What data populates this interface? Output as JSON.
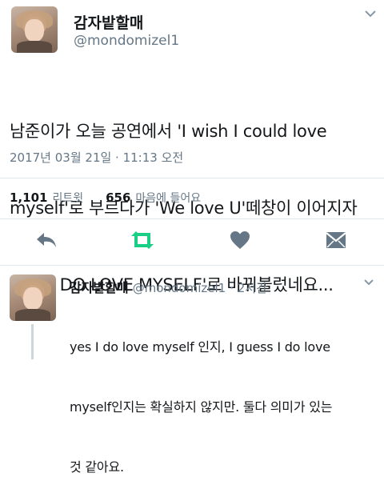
{
  "main_tweet": {
    "display_name": "감자밭할매",
    "handle": "@mondomizel1",
    "text_lines": [
      "남준이가 오늘 공연에서 'I wish I could love",
      "myself'로 부르다가 'We love U'떼창이 이어지자",
      "'YES I DO LOVE MYSELF'로 바꿔불렀네요..."
    ],
    "timestamp": "2017년 03월 21일 · 11:13 오전",
    "retweets_count": "1,101",
    "retweets_label": "리트윗",
    "likes_count": "656",
    "likes_label": "마음에 들어요"
  },
  "actions": {
    "reply_icon": "reply-icon",
    "retweet_icon": "retweet-icon",
    "like_icon": "heart-icon",
    "dm_icon": "envelope-icon",
    "retweet_color": "#19cf86"
  },
  "reply_tweet": {
    "display_name": "감자밭할매",
    "handle": "@mondomizel1",
    "time": "· 2시간",
    "text_lines": [
      "yes I do love myself 인지, I guess I do love",
      "myself인지는 확실하지 않지만. 둘다 의미가 있는",
      "것 같아요."
    ]
  }
}
